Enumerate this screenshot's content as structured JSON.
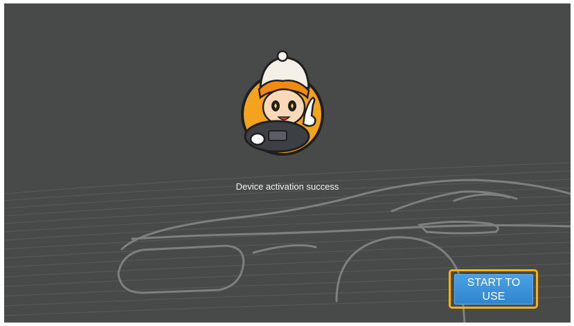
{
  "screen": {
    "background_color": "#474a49",
    "status_message": "Device activation success"
  },
  "mascot": {
    "icon": "driver-mascot-icon",
    "accent_color": "#f3a31c"
  },
  "start_button": {
    "label": "START TO USE",
    "color": "#3a92d8",
    "highlight_color": "#f3b31c"
  },
  "decor": {
    "icon": "car-outline-icon"
  }
}
